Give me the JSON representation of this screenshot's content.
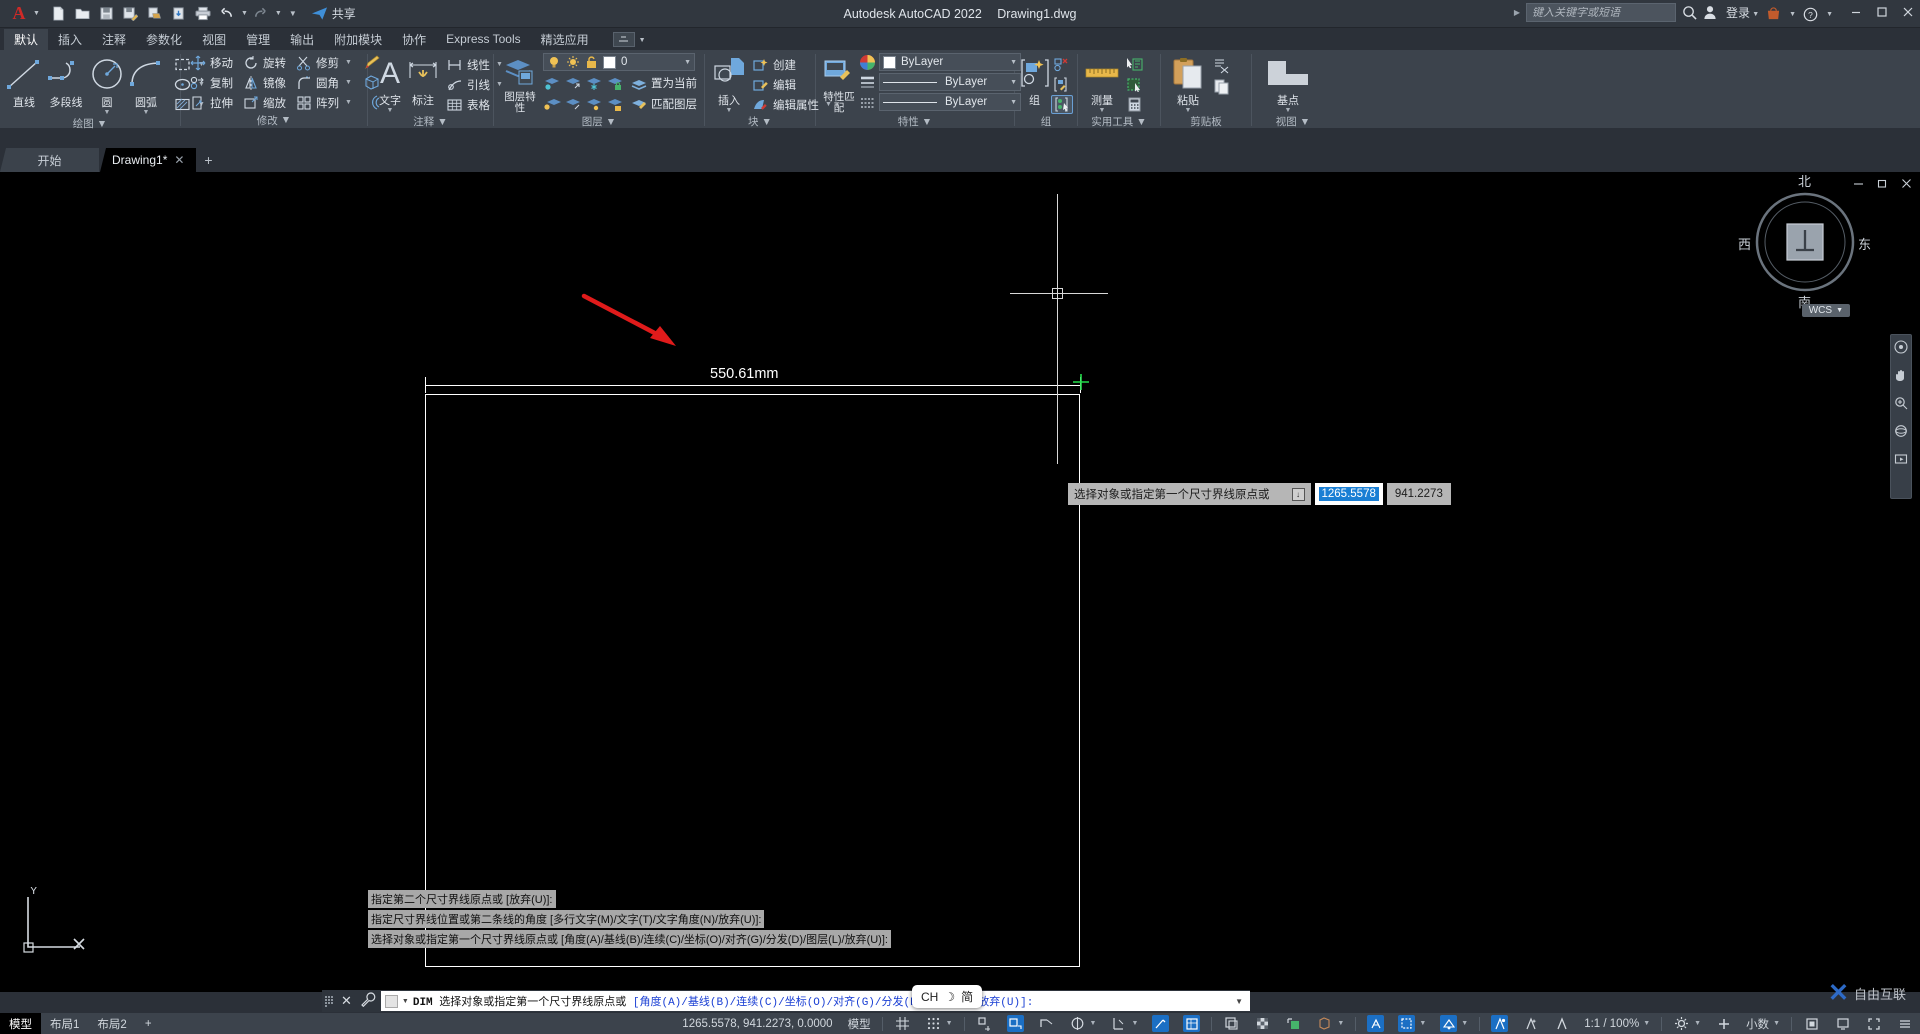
{
  "app": {
    "title": "Autodesk AutoCAD 2022",
    "document": "Drawing1.dwg",
    "logo": "A",
    "share_label": "共享",
    "signin_label": "登录"
  },
  "search": {
    "placeholder": "键入关键字或短语",
    "value": ""
  },
  "quick_access": [
    {
      "name": "new",
      "icon": "new-file-icon"
    },
    {
      "name": "open",
      "icon": "open-folder-icon"
    },
    {
      "name": "save",
      "icon": "save-icon"
    },
    {
      "name": "saveas",
      "icon": "save-as-icon"
    },
    {
      "name": "export",
      "icon": "export-icon"
    },
    {
      "name": "cloud",
      "icon": "cloud-save-icon"
    },
    {
      "name": "plot",
      "icon": "printer-icon"
    },
    {
      "name": "undo",
      "icon": "undo-icon"
    },
    {
      "name": "redo",
      "icon": "redo-icon"
    }
  ],
  "ribbon_tabs": [
    {
      "label": "默认",
      "active": true
    },
    {
      "label": "插入",
      "active": false
    },
    {
      "label": "注释",
      "active": false
    },
    {
      "label": "参数化",
      "active": false
    },
    {
      "label": "视图",
      "active": false
    },
    {
      "label": "管理",
      "active": false
    },
    {
      "label": "输出",
      "active": false
    },
    {
      "label": "附加模块",
      "active": false
    },
    {
      "label": "协作",
      "active": false
    },
    {
      "label": "Express Tools",
      "active": false
    },
    {
      "label": "精选应用",
      "active": false
    }
  ],
  "panels": {
    "draw": {
      "title": "绘图",
      "big": [
        {
          "label": "直线",
          "icon": "line-icon",
          "dropdown": false
        },
        {
          "label": "多段线",
          "icon": "polyline-icon",
          "dropdown": false
        },
        {
          "label": "圆",
          "icon": "circle-icon",
          "dropdown": true
        },
        {
          "label": "圆弧",
          "icon": "arc-icon",
          "dropdown": true
        }
      ],
      "small": [
        {
          "icon": "rectangle-icon",
          "dropdown": true
        },
        {
          "icon": "ellipse-icon",
          "dropdown": true
        },
        {
          "icon": "hatch-icon",
          "dropdown": true
        }
      ]
    },
    "modify": {
      "title": "修改",
      "rows": [
        [
          {
            "label": "移动",
            "icon": "move-icon"
          },
          {
            "label": "旋转",
            "icon": "rotate-icon"
          },
          {
            "label": "修剪",
            "icon": "trim-icon",
            "dropdown": true
          }
        ],
        [
          {
            "label": "复制",
            "icon": "copy-icon"
          },
          {
            "label": "镜像",
            "icon": "mirror-icon"
          },
          {
            "label": "圆角",
            "icon": "fillet-icon",
            "dropdown": true
          }
        ],
        [
          {
            "label": "拉伸",
            "icon": "stretch-icon"
          },
          {
            "label": "缩放",
            "icon": "scale-icon"
          },
          {
            "label": "阵列",
            "icon": "array-icon",
            "dropdown": true
          }
        ]
      ],
      "extras": [
        {
          "icon": "pencil-edit-icon"
        },
        {
          "icon": "3d-box-icon"
        },
        {
          "icon": "offset-icon"
        }
      ]
    },
    "annotation": {
      "title": "注释",
      "big": [
        {
          "label": "文字",
          "icon": "text-a-icon",
          "dropdown": true
        },
        {
          "label": "标注",
          "icon": "dimension-icon",
          "dropdown": false
        }
      ],
      "small": [
        {
          "label": "线性",
          "icon": "linear-dim-icon",
          "dropdown": true
        },
        {
          "label": "引线",
          "icon": "leader-icon",
          "dropdown": true
        },
        {
          "label": "表格",
          "icon": "table-icon",
          "dropdown": false
        }
      ]
    },
    "layers": {
      "title": "图层",
      "big": [
        {
          "label": "图层特性",
          "icon": "layer-properties-icon"
        }
      ],
      "layer_combo": {
        "name": "0",
        "color": "#ffffff"
      },
      "row2": [
        {
          "icon": "layer-off-icon"
        },
        {
          "icon": "layer-isolate-icon"
        },
        {
          "icon": "layer-freeze-icon"
        },
        {
          "icon": "layer-lock-icon"
        },
        {
          "label": "置为当前",
          "icon": "layer-set-current-icon"
        }
      ],
      "row3": [
        {
          "icon": "layer-on-icon"
        },
        {
          "icon": "layer-unisolate-icon"
        },
        {
          "icon": "layer-thaw-icon"
        },
        {
          "icon": "layer-unlock-icon"
        },
        {
          "label": "匹配图层",
          "icon": "layer-match-icon"
        }
      ]
    },
    "block": {
      "title": "块",
      "big": [
        {
          "label": "插入",
          "icon": "insert-block-icon",
          "dropdown": true
        }
      ],
      "small": [
        {
          "label": "创建",
          "icon": "create-block-icon"
        },
        {
          "label": "编辑",
          "icon": "edit-block-icon"
        },
        {
          "label": "编辑属性",
          "icon": "edit-attributes-icon",
          "dropdown": true
        }
      ]
    },
    "properties": {
      "title": "特性",
      "big": [
        {
          "label": "特性匹配",
          "icon": "match-properties-icon"
        }
      ],
      "combos": [
        {
          "icon": "color-wheel-icon",
          "value": "ByLayer",
          "swatch": "#ffffff"
        },
        {
          "icon": "lineweight-icon",
          "value": "ByLayer",
          "line": "solid"
        },
        {
          "icon": "linetype-icon",
          "value": "ByLayer",
          "line": "solid"
        }
      ]
    },
    "groups": {
      "title": "组",
      "big": [
        {
          "label": "组",
          "icon": "group-icon"
        }
      ],
      "small": [
        {
          "icon": "ungroup-icon"
        },
        {
          "icon": "group-edit-icon"
        },
        {
          "icon": "group-selection-icon",
          "active": true
        }
      ]
    },
    "utilities": {
      "title": "实用工具",
      "big": [
        {
          "label": "测量",
          "icon": "measure-icon",
          "dropdown": true
        }
      ],
      "small": [
        {
          "icon": "quick-select-icon"
        },
        {
          "icon": "select-all-icon"
        },
        {
          "icon": "calculator-icon"
        }
      ]
    },
    "clipboard": {
      "title": "剪贴板",
      "big": [
        {
          "label": "粘贴",
          "icon": "paste-icon",
          "dropdown": true
        }
      ],
      "small": [
        {
          "icon": "cut-icon"
        },
        {
          "icon": "copy-clip-icon"
        }
      ]
    },
    "view": {
      "title": "视图",
      "big": [
        {
          "label": "基点",
          "icon": "base-view-icon",
          "dropdown": true
        }
      ]
    }
  },
  "file_tabs": [
    {
      "label": "开始",
      "active": false,
      "closable": false
    },
    {
      "label": "Drawing1*",
      "active": true,
      "closable": true
    }
  ],
  "file_tab_add": "+",
  "canvas": {
    "dimension_text": "550.61mm",
    "tooltip": {
      "prompt": "选择对象或指定第一个尺寸界线原点或",
      "value_x": "1265.5578",
      "value_y": "941.2273",
      "dropdown_icon": "down-arrow-box-icon"
    },
    "viewcube": {
      "top": "上",
      "north": "北",
      "south": "南",
      "east": "东",
      "west": "西",
      "wcs": "WCS"
    },
    "ucs_axes": {
      "x": "X",
      "y": "Y"
    },
    "window_controls": {
      "minimize": "—",
      "restore": "❐",
      "close": "✕"
    }
  },
  "command_history": [
    {
      "text": "指定第二个尺寸界线原点或 [放弃(U)]:"
    },
    {
      "text": "指定尺寸界线位置或第二条线的角度 [多行文字(M)/文字(T)/文字角度(N)/放弃(U)]:"
    },
    {
      "text": "选择对象或指定第一个尺寸界线原点或 [角度(A)/基线(B)/连续(C)/坐标(O)/对齐(G)/分发(D)/图层(L)/放弃(U)]:"
    }
  ],
  "command_line": {
    "command": "DIM",
    "prompt": "选择对象或指定第一个尺寸界线原点或",
    "options": "[角度(A)/基线(B)/连续(C)/坐标(O)/对齐(G)/分发(D)/图层(L)/放弃(U)]:",
    "close_icon": "close-icon",
    "wrench_icon": "wrench-icon"
  },
  "ime_pill": {
    "lang": "CH",
    "mode": "简",
    "moon": "☽"
  },
  "status_bar": {
    "layout_tabs": [
      {
        "label": "模型",
        "active": true
      },
      {
        "label": "布局1",
        "active": false
      },
      {
        "label": "布局2",
        "active": false
      }
    ],
    "add_layout": "+",
    "coordinates": "1265.5578, 941.2273, 0.0000",
    "model_label": "模型",
    "scale": "1:1 / 100%",
    "decimal_label": "小数",
    "toggles": [
      {
        "name": "grid-display-toggle",
        "icon": "grid-icon",
        "on": false
      },
      {
        "name": "snap-mode-toggle",
        "icon": "snap-icon",
        "on": false
      },
      {
        "name": "ortho-mode-toggle",
        "icon": "ortho-icon",
        "on": false
      },
      {
        "name": "polar-tracking-toggle",
        "icon": "polar-icon",
        "on": true
      },
      {
        "name": "isometric-drafting-toggle",
        "icon": "isoplane-icon",
        "on": false
      },
      {
        "name": "object-snap-tracking-toggle",
        "icon": "otrack-icon",
        "on": false
      },
      {
        "name": "object-snap-toggle",
        "icon": "osnap-icon",
        "on": true
      },
      {
        "name": "lineweight-toggle",
        "icon": "lineweight-status-icon",
        "on": false
      },
      {
        "name": "transparency-toggle",
        "icon": "transparency-icon",
        "on": true
      },
      {
        "name": "selection-cycling-toggle",
        "icon": "selection-cycling-icon",
        "on": false
      },
      {
        "name": "3d-object-snap-toggle",
        "icon": "3d-osnap-icon",
        "on": false
      },
      {
        "name": "dynamic-ucs-toggle",
        "icon": "dynamic-ucs-icon",
        "on": true
      },
      {
        "name": "selection-filter-toggle",
        "icon": "selection-filter-icon",
        "on": true
      },
      {
        "name": "gizmo-toggle",
        "icon": "gizmo-icon",
        "on": false
      },
      {
        "name": "annotation-visibility-toggle",
        "icon": "annotation-visibility-icon",
        "on": true
      },
      {
        "name": "autoscale-toggle",
        "icon": "autoscale-icon",
        "on": false
      },
      {
        "name": "annotation-scale-toggle",
        "icon": "annotation-scale-icon",
        "on": false
      }
    ],
    "right_icons": [
      {
        "name": "workspace-switching",
        "icon": "gear-icon"
      },
      {
        "name": "hardware-acceleration",
        "icon": "plus-icon"
      },
      {
        "name": "isolate-objects",
        "icon": "lightbulb-icon"
      },
      {
        "name": "clean-screen",
        "icon": "fullscreen-icon"
      },
      {
        "name": "customization",
        "icon": "hamburger-icon"
      }
    ]
  },
  "watermark": {
    "text": "自由互联"
  }
}
